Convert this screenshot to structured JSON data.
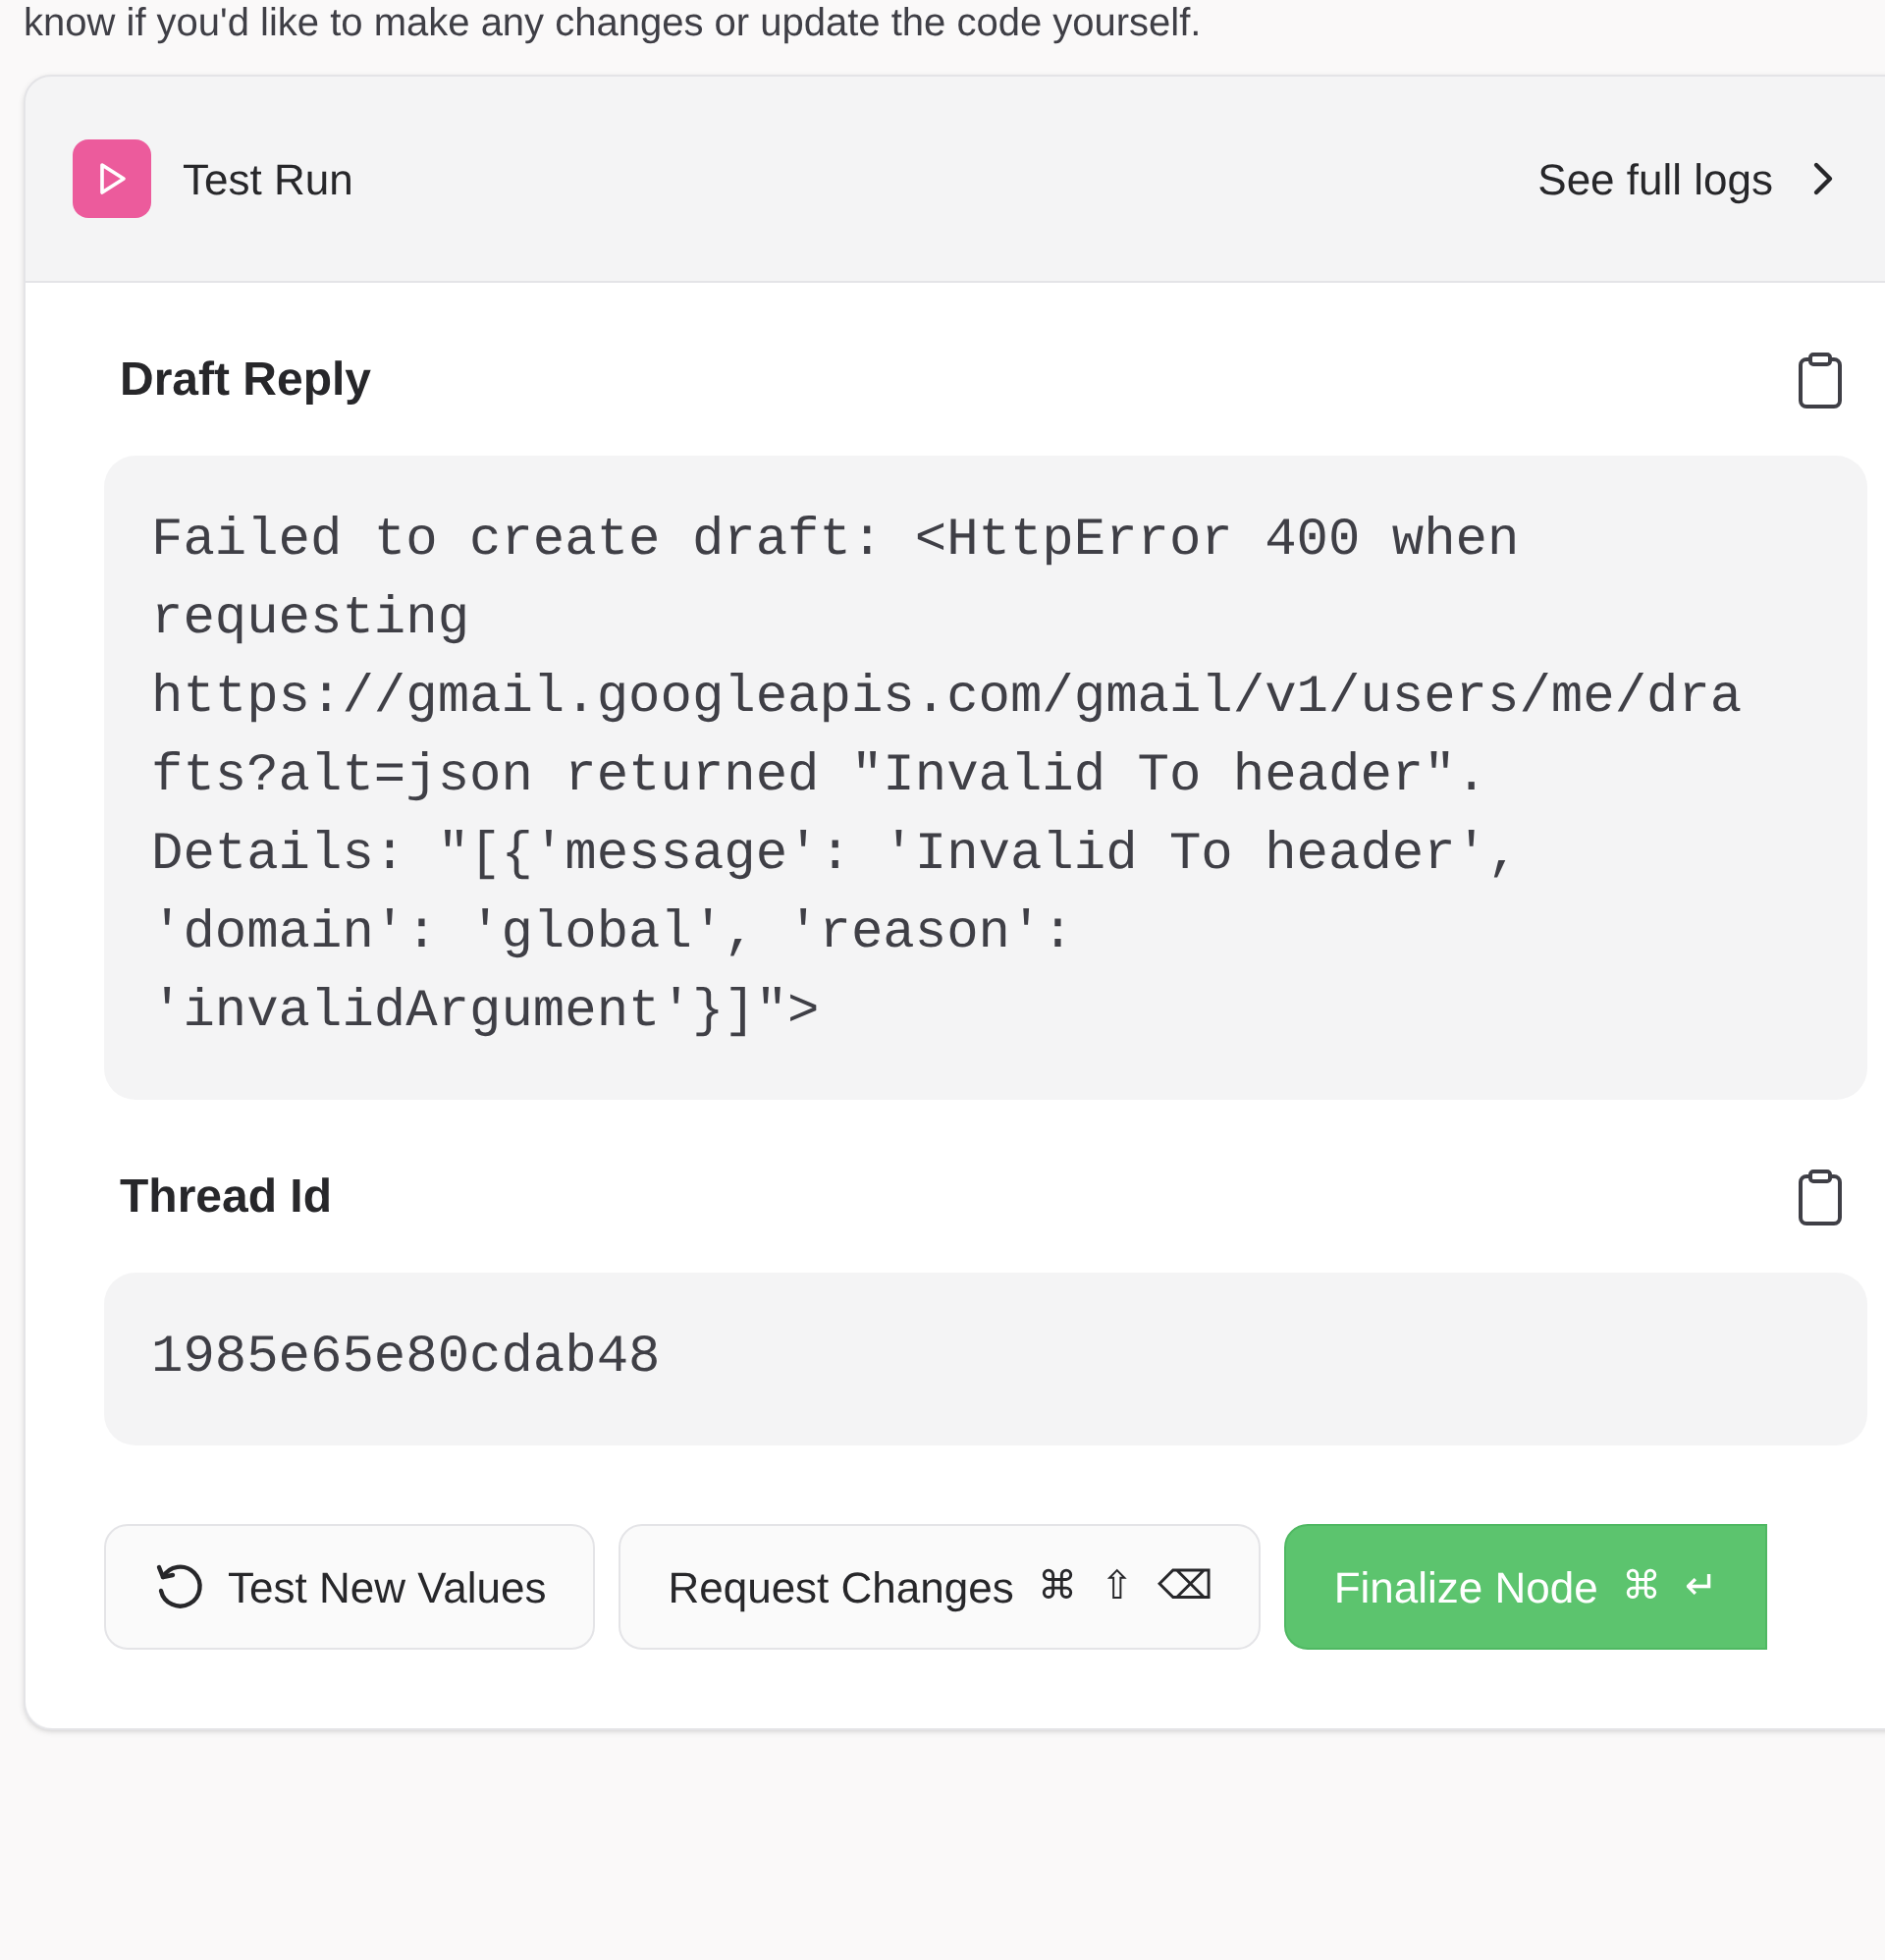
{
  "intro_text": "know if you'd like to make any changes or update the code yourself.",
  "panel": {
    "title": "Test Run",
    "logs_link": "See full logs"
  },
  "fields": [
    {
      "label": "Draft Reply",
      "value": "Failed to create draft: <HttpError 400 when requesting https://gmail.googleapis.com/gmail/v1/users/me/drafts?alt=json returned \"Invalid To header\". Details: \"[{'message': 'Invalid To header', 'domain': 'global', 'reason': 'invalidArgument'}]\">"
    },
    {
      "label": "Thread Id",
      "value": "1985e65e80cdab48"
    }
  ],
  "buttons": [
    {
      "kind": "retry",
      "label": "Test New Values"
    },
    {
      "kind": "secondary",
      "label": "Request Changes",
      "shortcut": [
        "⌘",
        "⇧",
        "⌫"
      ]
    },
    {
      "kind": "primary",
      "label": "Finalize Node",
      "shortcut": [
        "⌘",
        "↵"
      ]
    }
  ]
}
